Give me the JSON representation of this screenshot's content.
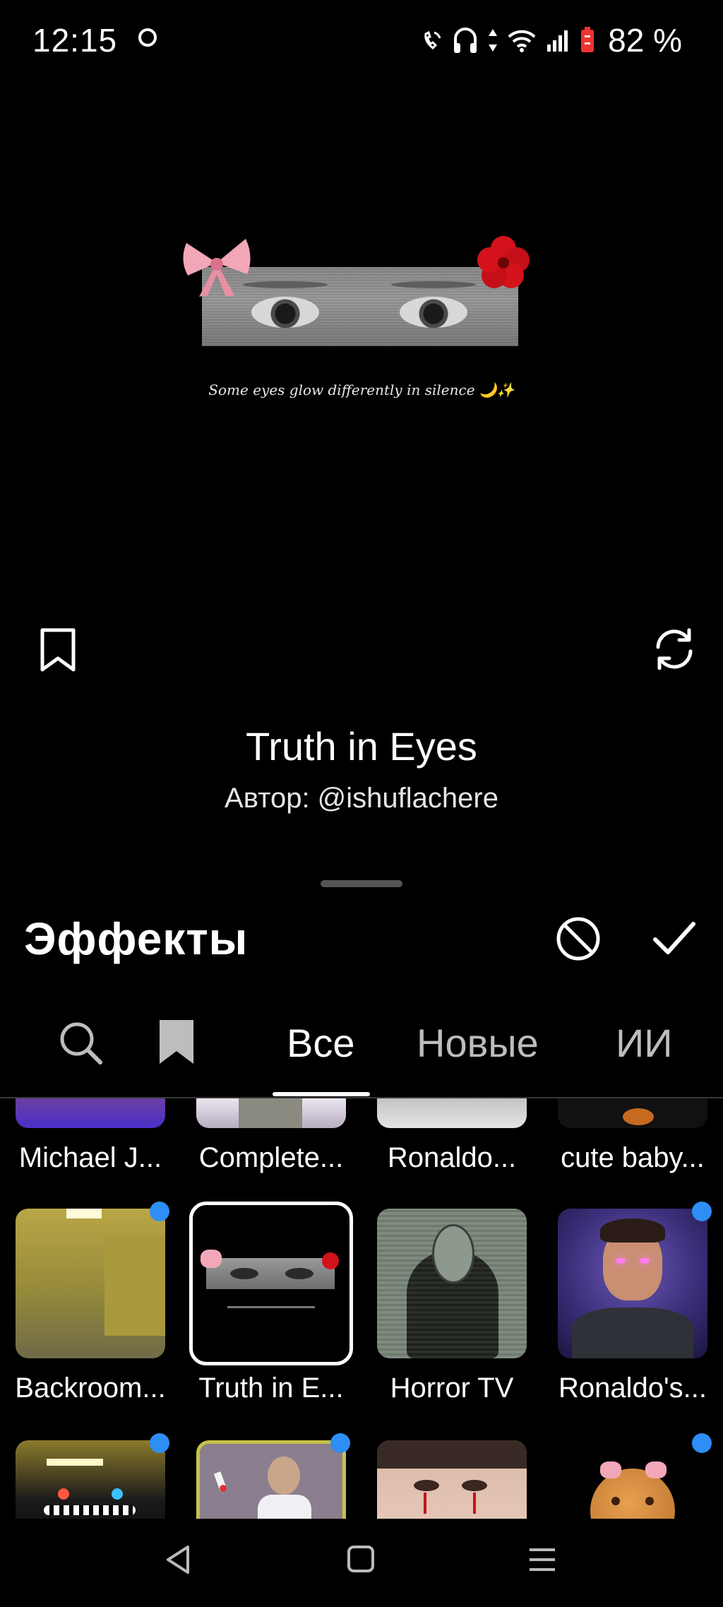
{
  "status_bar": {
    "time": "12:15",
    "battery": "82 %",
    "icons": [
      "notification-icon",
      "wifi-call-icon",
      "headphones-icon",
      "data-arrows-icon",
      "wifi-icon",
      "signal-icon",
      "battery-icon"
    ]
  },
  "preview": {
    "caption": "Some eyes glow differently in silence 🌙✨"
  },
  "effect": {
    "name": "Truth in Eyes",
    "author": "Автор: @ishuflachere"
  },
  "sheet": {
    "title": "Эффекты",
    "icons": [
      "none-icon",
      "check-icon"
    ]
  },
  "tabs": {
    "items": [
      "Все",
      "Новые",
      "ИИ"
    ],
    "active": "Все",
    "icons": [
      "search-icon",
      "bookmark-icon"
    ]
  },
  "grid": {
    "row1": [
      "Michael J...",
      "Complete...",
      "Ronaldo...",
      "cute baby..."
    ],
    "row2": [
      "Backroom...",
      "Truth in E...",
      "Horror TV",
      "Ronaldo's..."
    ],
    "row3_count": 4,
    "selected": "Truth in E..."
  },
  "colors": {
    "background": "#000000",
    "new_dot": "#2f8ef5",
    "text": "#ffffff"
  }
}
